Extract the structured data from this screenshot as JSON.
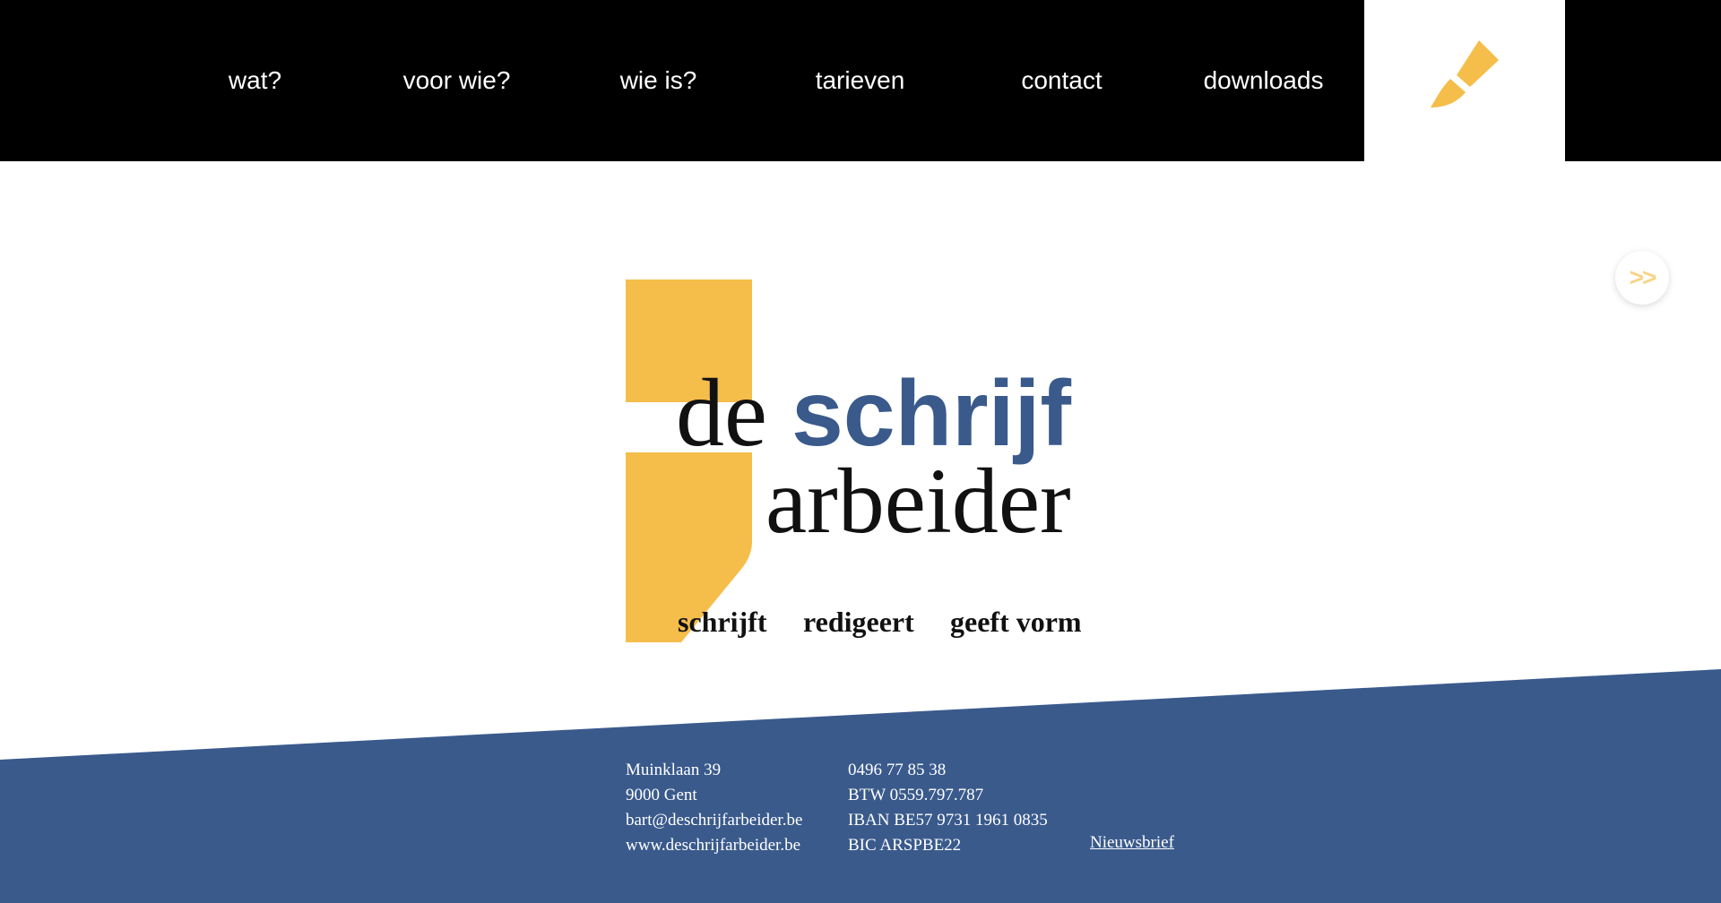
{
  "colors": {
    "nav_bg": "#000000",
    "nav_text": "#ffffff",
    "accent_yellow": "#f5bd4a",
    "brand_blue": "#3a5a8c",
    "footer_text": "#ffffff",
    "logo_text": "#111111"
  },
  "nav": {
    "items": [
      {
        "label": "wat?"
      },
      {
        "label": "voor wie?"
      },
      {
        "label": "wie is?"
      },
      {
        "label": "tarieven"
      },
      {
        "label": "contact"
      },
      {
        "label": "downloads"
      }
    ],
    "home_icon": "pen-nib-icon"
  },
  "slider": {
    "next_label": ">>"
  },
  "logo": {
    "word_de": "de",
    "word_schrijf": "schrijf",
    "word_arbeider": "arbeider",
    "taglines": [
      "schrijft",
      "redigeert",
      "geeft vorm"
    ]
  },
  "footer": {
    "col1": [
      "Muinklaan 39",
      "9000 Gent",
      "bart@deschrijfarbeider.be",
      "www.deschrijfarbeider.be"
    ],
    "col2": [
      "0496 77 85 38",
      "BTW 0559.797.787",
      "IBAN BE57 9731 1961 0835",
      "BIC ARSPBE22"
    ],
    "newsletter_label": "Nieuwsbrief"
  }
}
